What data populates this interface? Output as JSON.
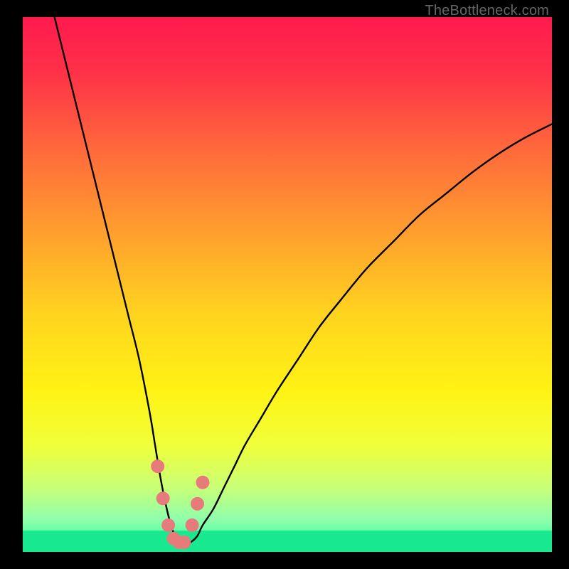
{
  "watermark": "TheBottleneck.com",
  "chart_data": {
    "type": "line",
    "title": "",
    "xlabel": "",
    "ylabel": "",
    "xlim": [
      0,
      100
    ],
    "ylim": [
      0,
      100
    ],
    "series": [
      {
        "name": "curve",
        "x": [
          6,
          8,
          10,
          12,
          14,
          16,
          18,
          20,
          22,
          24,
          25,
          26,
          27,
          28,
          29,
          30,
          31,
          32,
          33,
          34,
          36,
          38,
          40,
          42,
          45,
          48,
          52,
          56,
          60,
          65,
          70,
          75,
          80,
          85,
          90,
          95,
          100
        ],
        "y": [
          100,
          92,
          84,
          76,
          68,
          60,
          52,
          44,
          36,
          26,
          20,
          14,
          9,
          5,
          2.5,
          1.5,
          1.5,
          2,
          3,
          5,
          8,
          12,
          16,
          20,
          25,
          30,
          36,
          42,
          47,
          53,
          58,
          63,
          67,
          71,
          74.5,
          77.5,
          80
        ]
      }
    ],
    "markers": {
      "name": "dots",
      "color": "#e77b7b",
      "x": [
        25.5,
        26.5,
        27.5,
        28.5,
        29.5,
        30.5,
        32.0,
        33.0,
        34.0
      ],
      "y": [
        16,
        10,
        5,
        2.5,
        1.8,
        1.8,
        5,
        9,
        13
      ]
    },
    "background": {
      "type": "vertical-gradient",
      "stops": [
        {
          "offset": 0.0,
          "color": "#ff1a4d"
        },
        {
          "offset": 0.1,
          "color": "#ff3049"
        },
        {
          "offset": 0.25,
          "color": "#ff6a3b"
        },
        {
          "offset": 0.4,
          "color": "#ff9e2e"
        },
        {
          "offset": 0.55,
          "color": "#ffd21f"
        },
        {
          "offset": 0.7,
          "color": "#fff314"
        },
        {
          "offset": 0.8,
          "color": "#f0ff3a"
        },
        {
          "offset": 0.88,
          "color": "#c8ff77"
        },
        {
          "offset": 0.94,
          "color": "#8effac"
        },
        {
          "offset": 1.0,
          "color": "#22ff99"
        }
      ]
    },
    "bottom_band": {
      "from_y": 0,
      "to_y": 4,
      "color": "#18e88f"
    }
  }
}
